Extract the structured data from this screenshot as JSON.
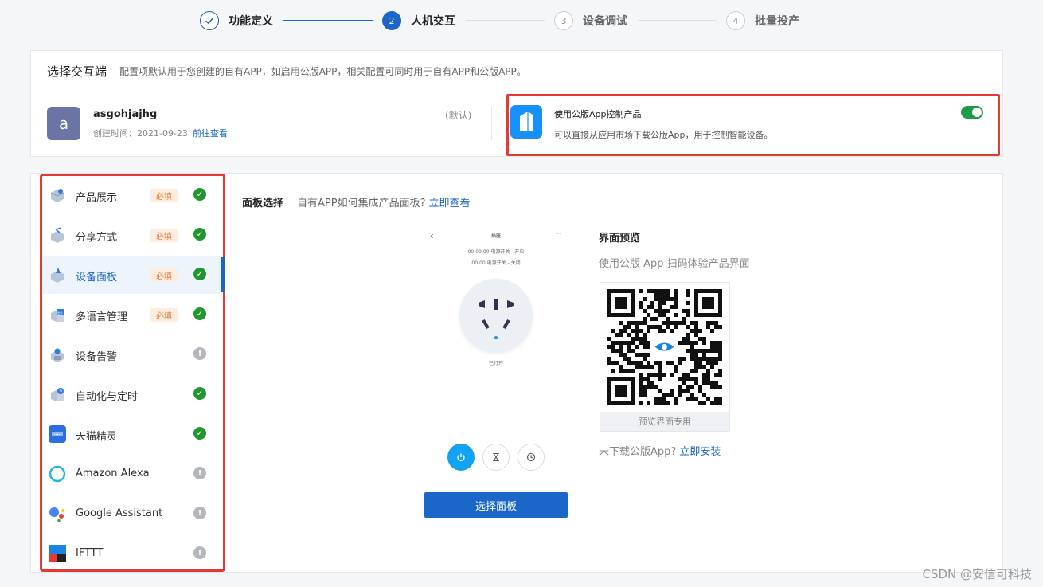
{
  "steps": [
    {
      "num": "1",
      "label": "功能定义",
      "state": "done"
    },
    {
      "num": "2",
      "label": "人机交互",
      "state": "active"
    },
    {
      "num": "3",
      "label": "设备调试",
      "state": "todo"
    },
    {
      "num": "4",
      "label": "批量投产",
      "state": "todo"
    }
  ],
  "interaction": {
    "title": "选择交互端",
    "desc": "配置项默认用于您创建的自有APP，如启用公版APP，相关配置可同时用于自有APP和公版APP。",
    "app": {
      "avatar_letter": "a",
      "name": "asgohjajhg",
      "created_prefix": "创建时间：",
      "created_date": "2021-09-23",
      "view_link": "前往查看",
      "default_tag": "(默认)"
    },
    "public_app": {
      "title": "使用公版App控制产品",
      "desc": "可以直接从应用市场下载公版App，用于控制智能设备。",
      "enabled": true
    }
  },
  "sidebar": {
    "required_label": "必填",
    "items": [
      {
        "label": "产品展示",
        "required": true,
        "status": "ok",
        "icon": "product-display-icon"
      },
      {
        "label": "分享方式",
        "required": true,
        "status": "ok",
        "icon": "share-icon"
      },
      {
        "label": "设备面板",
        "required": true,
        "status": "ok",
        "icon": "device-panel-icon",
        "active": true
      },
      {
        "label": "多语言管理",
        "required": true,
        "status": "ok",
        "icon": "language-icon"
      },
      {
        "label": "设备告警",
        "required": false,
        "status": "warn",
        "icon": "alarm-icon"
      },
      {
        "label": "自动化与定时",
        "required": false,
        "status": "ok",
        "icon": "automation-icon"
      },
      {
        "label": "天猫精灵",
        "required": false,
        "status": "ok",
        "icon": "tmall-genie-icon"
      },
      {
        "label": "Amazon Alexa",
        "required": false,
        "status": "warn",
        "icon": "alexa-icon"
      },
      {
        "label": "Google Assistant",
        "required": false,
        "status": "warn",
        "icon": "google-assistant-icon"
      },
      {
        "label": "IFTTT",
        "required": false,
        "status": "warn",
        "icon": "ifttt-icon"
      }
    ]
  },
  "panel": {
    "title": "面板选择",
    "sub": "自有APP如何集成产品面板?",
    "sub_link": "立即查看",
    "phone": {
      "back": "‹",
      "title": "插座",
      "more": "···",
      "line1": "00:00:00 电源开关 - 开启",
      "line2": "00:00 电源开关 - 关闭",
      "state": "已打开"
    },
    "select_button": "选择面板"
  },
  "preview": {
    "title": "界面预览",
    "desc": "使用公版 App 扫码体验产品界面",
    "qr_caption": "预览界面专用",
    "install_text": "未下载公版App?",
    "install_link": "立即安装"
  },
  "watermark": "CSDN @安信可科技",
  "colors": {
    "accent": "#1b66c9",
    "ok": "#22962f",
    "toggle_on": "#1e9b47",
    "highlight_border": "#e53935"
  }
}
